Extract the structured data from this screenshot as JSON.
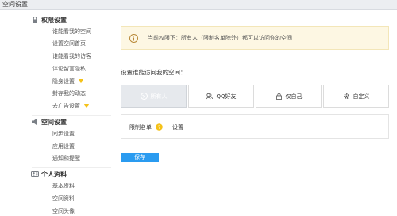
{
  "window": {
    "title": "空间设置"
  },
  "sidebar": {
    "groups": [
      {
        "title": "权限设置",
        "icon": "lock-icon",
        "items": [
          {
            "label": "谁能看我的空间"
          },
          {
            "label": "设置空间首页"
          },
          {
            "label": "谁能看我的访客"
          },
          {
            "label": "评论留言隐私"
          },
          {
            "label": "隐身设置",
            "badge": "diamond-icon"
          },
          {
            "label": "封存我的动态"
          },
          {
            "label": "去广告设置",
            "badge": "diamond-icon"
          }
        ]
      },
      {
        "title": "空间设置",
        "icon": "speaker-icon",
        "items": [
          {
            "label": "同步设置"
          },
          {
            "label": "应用设置"
          },
          {
            "label": "通知和提醒"
          }
        ]
      },
      {
        "title": "个人资料",
        "icon": "person-card-icon",
        "items": [
          {
            "label": "基本资料"
          },
          {
            "label": "空间资料"
          },
          {
            "label": "空间头像"
          }
        ]
      }
    ]
  },
  "main": {
    "notice": {
      "text": "当前权限下：所有人（限制名单除外）都可以访问你的空间",
      "icon": "info-icon"
    },
    "section_label": "设置谁能访问我的空间：",
    "options": [
      {
        "label": "所有人",
        "icon": "globe-icon",
        "selected": true
      },
      {
        "label": "QQ好友",
        "icon": "friends-icon",
        "selected": false
      },
      {
        "label": "仅自己",
        "icon": "lock-icon",
        "selected": false
      },
      {
        "label": "自定义",
        "icon": "gear-icon",
        "selected": false
      }
    ],
    "restrict": {
      "label": "限制名单",
      "help_icon": "question-icon",
      "link": "设置"
    },
    "save_label": "保存"
  },
  "colors": {
    "accent": "#2a9bf0",
    "diamond": "#f5c219",
    "notice_bg": "#fdf7e3"
  }
}
